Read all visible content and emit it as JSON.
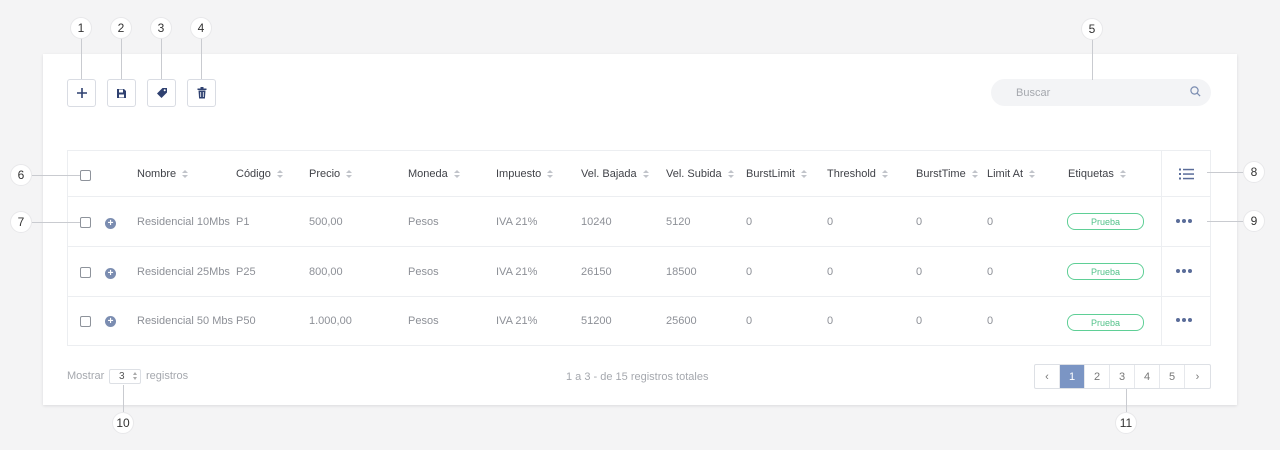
{
  "callouts": [
    "1",
    "2",
    "3",
    "4",
    "5",
    "6",
    "7",
    "8",
    "9",
    "10",
    "11"
  ],
  "toolbar": {
    "add_icon": "plus-icon",
    "save_icon": "floppy-disk-icon",
    "tag_icon": "tag-icon",
    "delete_icon": "trash-icon"
  },
  "search": {
    "placeholder": "Buscar",
    "icon": "search-icon"
  },
  "table": {
    "columns": [
      "Nombre",
      "Código",
      "Precio",
      "Moneda",
      "Impuesto",
      "Vel. Bajada",
      "Vel. Subida",
      "BurstLimit",
      "Threshold",
      "BurstTime",
      "Limit At",
      "Etiquetas"
    ],
    "column_toggle_icon": "list-icon",
    "rows": [
      [
        "Residencial 10Mbs",
        "P1",
        "500,00",
        "Pesos",
        "IVA 21%",
        "10240",
        "5120",
        "0",
        "0",
        "0",
        "0",
        "Prueba"
      ],
      [
        "Residencial 25Mbs",
        "P25",
        "800,00",
        "Pesos",
        "IVA 21%",
        "26150",
        "18500",
        "0",
        "0",
        "0",
        "0",
        "Prueba"
      ],
      [
        "Residencial 50 Mbs",
        "P50",
        "1.000,00",
        "Pesos",
        "IVA 21%",
        "51200",
        "25600",
        "0",
        "0",
        "0",
        "0",
        "Prueba"
      ]
    ]
  },
  "footer": {
    "show_label": "Mostrar",
    "page_size": "3",
    "records_label": "registros",
    "summary": "1 a 3 - de 15 registros totales",
    "pages": [
      "1",
      "2",
      "3",
      "4",
      "5"
    ],
    "prev": "‹",
    "next": "›",
    "active_page": "1"
  },
  "colors": {
    "accent": "#7b95c4",
    "tag": "#53c28a",
    "dots": "#5a6c99"
  }
}
